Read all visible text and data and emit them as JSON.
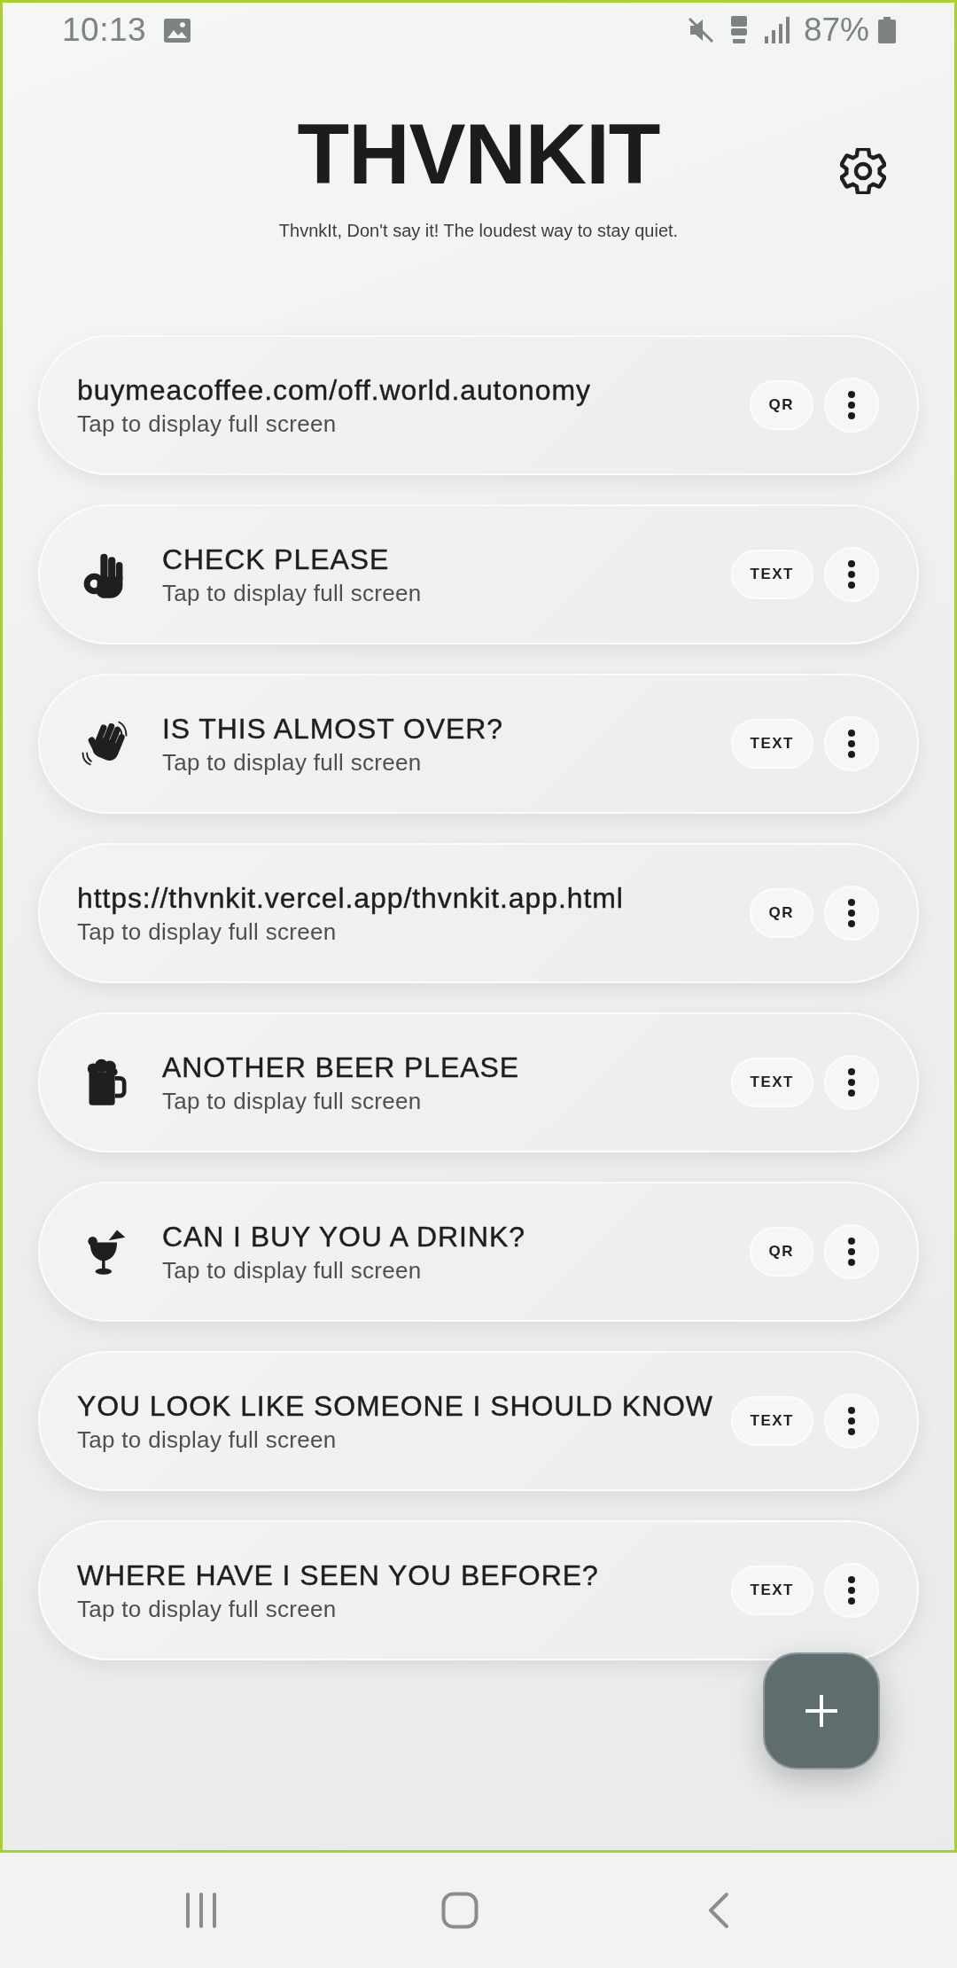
{
  "status_bar": {
    "time": "10:13",
    "battery": "87%"
  },
  "header": {
    "title": "THVNKIT",
    "tagline": "ThvnkIt, Don't say it! The loudest way to stay quiet."
  },
  "cards": [
    {
      "kind": "plain",
      "title": "buymeacoffee.com/off.world.autonomy",
      "subtitle": "Tap to display full screen",
      "badge": "QR"
    },
    {
      "kind": "okhand",
      "title": "CHECK PLEASE",
      "subtitle": "Tap to display full screen",
      "badge": "TEXT"
    },
    {
      "kind": "wave",
      "title": "IS THIS ALMOST OVER?",
      "subtitle": "Tap to display full screen",
      "badge": "TEXT"
    },
    {
      "kind": "plain",
      "title": "https://thvnkit.vercel.app/thvnkit.app.html",
      "subtitle": "Tap to display full screen",
      "badge": "QR"
    },
    {
      "kind": "beer",
      "title": "ANOTHER BEER PLEASE",
      "subtitle": "Tap to display full screen",
      "badge": "TEXT"
    },
    {
      "kind": "drink",
      "title": "CAN I BUY YOU A DRINK?",
      "subtitle": "Tap to display full screen",
      "badge": "QR"
    },
    {
      "kind": "plain",
      "title": "YOU LOOK LIKE SOMEONE I SHOULD KNOW",
      "subtitle": "Tap to display full screen",
      "badge": "TEXT"
    },
    {
      "kind": "plain",
      "title": "WHERE HAVE I SEEN YOU BEFORE?",
      "subtitle": "Tap to display full screen",
      "badge": "TEXT"
    }
  ]
}
